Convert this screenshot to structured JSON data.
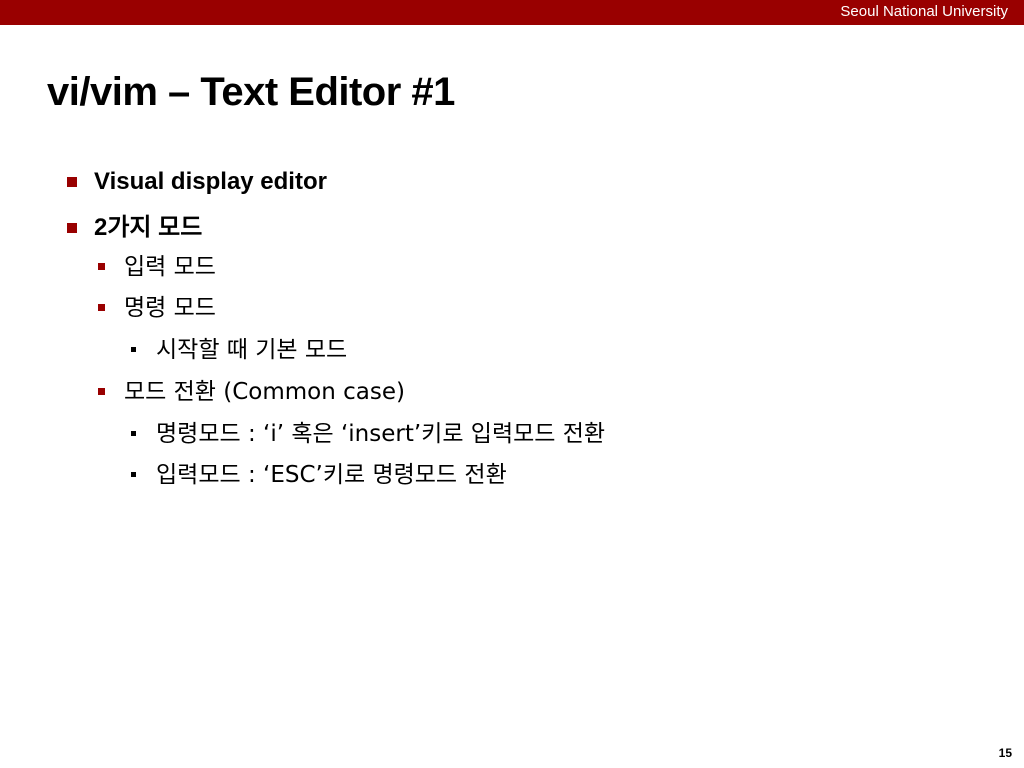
{
  "header": {
    "organization": "Seoul National University",
    "bar_color": "#990000"
  },
  "slide": {
    "title": "vi/vim – Text Editor #1",
    "page_number": "15",
    "bullet_color": "#990000",
    "bullets": [
      {
        "level": 1,
        "text": "Visual display editor"
      },
      {
        "level": 1,
        "text": "2가지 모드"
      },
      {
        "level": 2,
        "text": "입력 모드"
      },
      {
        "level": 2,
        "text": "명령 모드"
      },
      {
        "level": 3,
        "text": "시작할 때 기본 모드"
      },
      {
        "level": 2,
        "text": "모드 전환 (Common case)"
      },
      {
        "level": 3,
        "text": "명령모드 : ‘i’ 혹은 ‘insert’키로 입력모드 전환"
      },
      {
        "level": 3,
        "text": "입력모드 : ‘ESC’키로 명령모드 전환"
      }
    ]
  }
}
